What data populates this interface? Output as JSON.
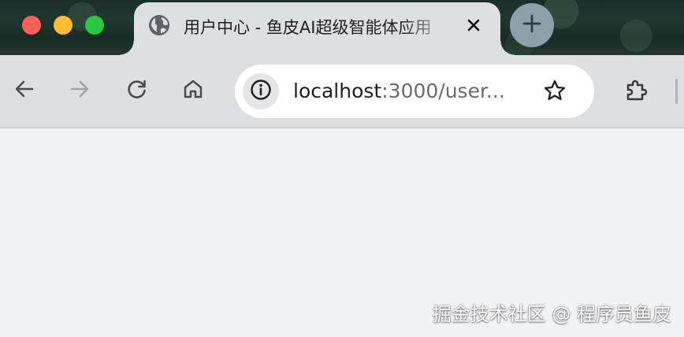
{
  "window": {
    "controls": {
      "close_color": "#ff5f57",
      "minimize_color": "#febc2e",
      "maximize_color": "#28c840"
    }
  },
  "tab": {
    "icon": "globe-icon",
    "title": "用户中心 - 鱼皮AI超级智能体应用",
    "close_icon": "close-icon"
  },
  "new_tab": {
    "icon": "plus-icon"
  },
  "toolbar": {
    "back_icon": "arrow-left-icon",
    "forward_icon": "arrow-right-icon",
    "reload_icon": "reload-icon",
    "home_icon": "home-icon",
    "extensions_icon": "puzzle-icon"
  },
  "address_bar": {
    "site_info_icon": "info-icon",
    "host": "localhost",
    "rest": ":3000/user...",
    "bookmark_icon": "star-icon"
  },
  "watermark": {
    "text": "掘金技术社区 @ 程序员鱼皮"
  }
}
